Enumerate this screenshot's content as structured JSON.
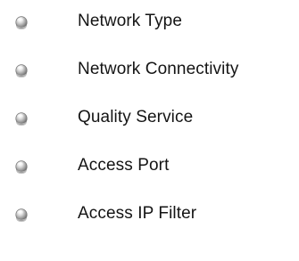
{
  "menu": {
    "items": [
      {
        "label": "Network Type",
        "icon": "gray-orb-bullet-icon"
      },
      {
        "label": "Network Connectivity",
        "icon": "gray-orb-bullet-icon"
      },
      {
        "label": "Quality Service",
        "icon": "gray-orb-bullet-icon"
      },
      {
        "label": "Access Port",
        "icon": "gray-orb-bullet-icon"
      },
      {
        "label": "Access IP Filter",
        "icon": "gray-orb-bullet-icon"
      }
    ]
  }
}
